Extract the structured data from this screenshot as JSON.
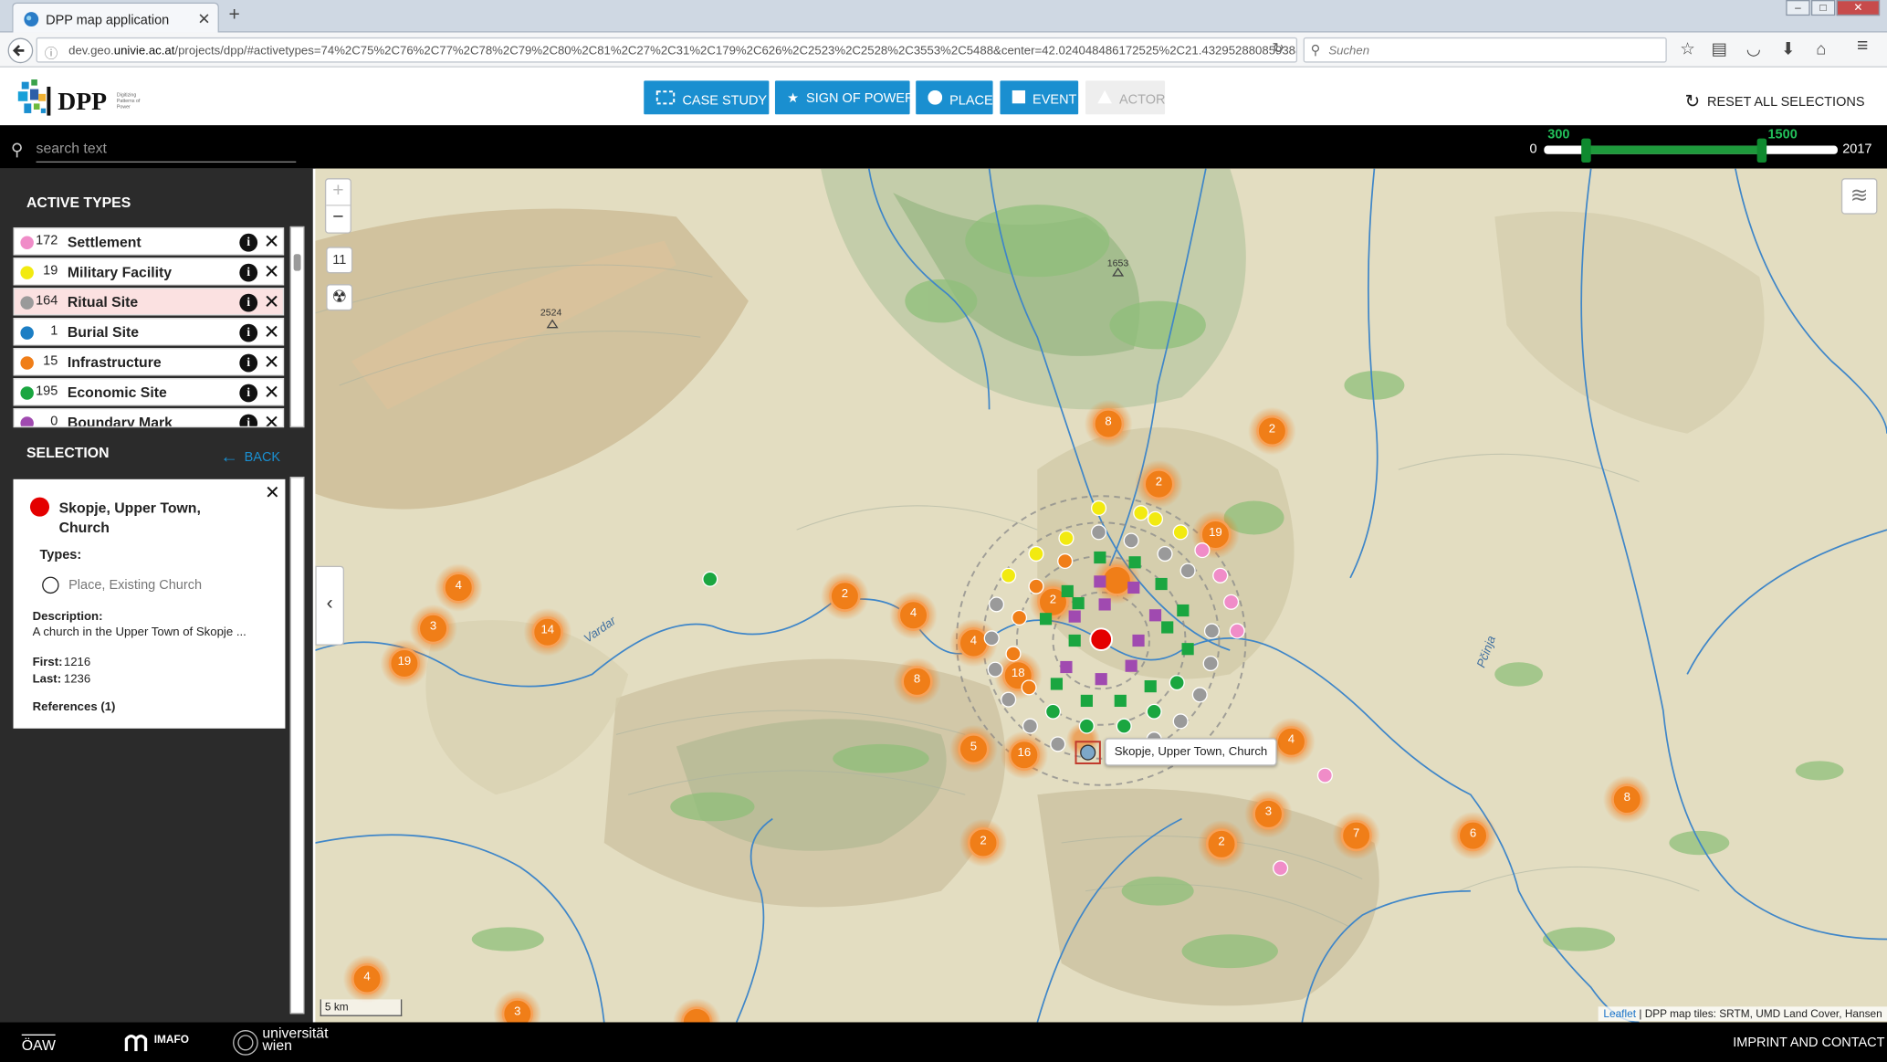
{
  "browser": {
    "tab_title": "DPP map application",
    "url_prefix": "dev.geo.",
    "url_domain": "univie.ac.at",
    "url_rest": "/projects/dpp/#activetypes=74%2C75%2C76%2C77%2C78%2C79%2C80%2C81%2C27%2C31%2C179%2C626%2C2523%2C2528%2C3553%2C5488&center=42.024048486172525%2C21.43295288085938&selecti",
    "search_placeholder": "Suchen"
  },
  "header": {
    "logo": "DPP",
    "logo_sub": "Digitizing Patterns of Power",
    "buttons": {
      "case_study": "CASE STUDY",
      "sign_of_power": "SIGN OF POWER",
      "place": "PLACE",
      "event": "EVENT",
      "actor": "ACTOR"
    },
    "reset": "RESET ALL SELECTIONS"
  },
  "toolbar": {
    "search_placeholder": "search text",
    "slider": {
      "min": "0",
      "max": "2017",
      "from": "300",
      "to": "1500"
    }
  },
  "sidebar": {
    "active_types_title": "ACTIVE TYPES",
    "types": [
      {
        "count": "172",
        "name": "Settlement",
        "color": "#f08cc8"
      },
      {
        "count": "19",
        "name": "Military Facility",
        "color": "#f2ea10"
      },
      {
        "count": "164",
        "name": "Ritual Site",
        "color": "#9a9a9a"
      },
      {
        "count": "1",
        "name": "Burial Site",
        "color": "#1c7ec4"
      },
      {
        "count": "15",
        "name": "Infrastructure",
        "color": "#f07e18"
      },
      {
        "count": "195",
        "name": "Economic Site",
        "color": "#1aa640"
      },
      {
        "count": "0",
        "name": "Boundary Mark",
        "color": "#a04ab0"
      }
    ],
    "selection_title": "SELECTION",
    "back": "BACK",
    "detail": {
      "title": "Skopje, Upper Town, Church",
      "types_label": "Types:",
      "type_value": "Place, Existing Church",
      "description_label": "Description:",
      "description": "A church in the Upper Town of Skopje ...",
      "first_label": "First:",
      "first": "1216",
      "last_label": "Last:",
      "last": "1236",
      "references": "References (1)"
    }
  },
  "map": {
    "zoom_level": "11",
    "tooltip": "Skopje, Upper Town, Church",
    "scale": "5 km",
    "attribution_link": "Leaflet",
    "attribution": "| DPP map tiles: SRTM, UMD Land Cover, Hansen",
    "river_labels": [
      "Vardar",
      "Pčinja"
    ],
    "peaks": [
      "2524",
      "1653"
    ],
    "clusters": [
      "8",
      "2",
      "2",
      "19",
      "4",
      "3",
      "14",
      "19",
      "2",
      "4",
      "2",
      "4",
      "8",
      "18",
      "5",
      "16",
      "4",
      "2",
      "2",
      "3",
      "7",
      "6",
      "8",
      "4",
      "3"
    ]
  },
  "footer": {
    "oaw": "ÖAW",
    "imafo": "IMAFO",
    "uni": "universität wien",
    "imprint": "IMPRINT AND CONTACT"
  }
}
